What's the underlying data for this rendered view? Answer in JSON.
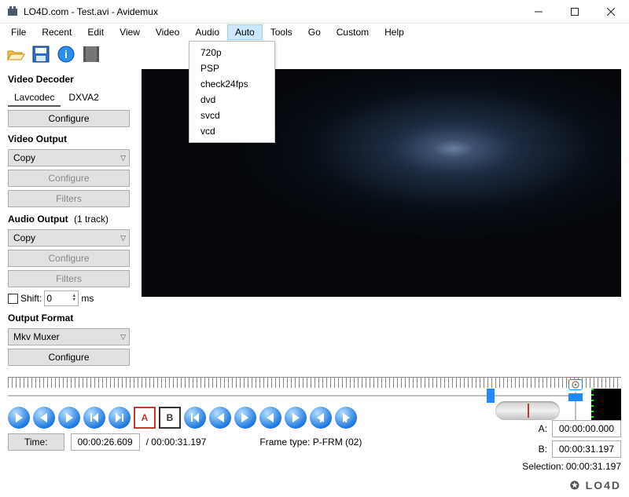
{
  "window": {
    "title": "LO4D.com - Test.avi - Avidemux"
  },
  "menu": {
    "items": [
      "File",
      "Recent",
      "Edit",
      "View",
      "Video",
      "Audio",
      "Auto",
      "Tools",
      "Go",
      "Custom",
      "Help"
    ],
    "open_index": 6,
    "dropdown": [
      "720p",
      "PSP",
      "check24fps",
      "dvd",
      "svcd",
      "vcd"
    ]
  },
  "toolbar_icons": [
    "open-icon",
    "save-icon",
    "info-icon",
    "film-icon"
  ],
  "sidebar": {
    "decoder": {
      "label": "Video Decoder",
      "tabs": [
        "Lavcodec",
        "DXVA2"
      ],
      "active_tab": 0,
      "configure": "Configure"
    },
    "video_out": {
      "label": "Video Output",
      "select": "Copy",
      "configure": "Configure",
      "filters": "Filters"
    },
    "audio_out": {
      "label": "Audio Output",
      "tracks_suffix": "(1 track)",
      "select": "Copy",
      "configure": "Configure",
      "filters": "Filters",
      "shift_label": "Shift:",
      "shift_value": "0",
      "shift_unit": "ms"
    },
    "output_fmt": {
      "label": "Output Format",
      "select": "Mkv Muxer",
      "configure": "Configure"
    }
  },
  "status": {
    "time_label": "Time:",
    "time_value": "00:00:26.609",
    "duration": "/ 00:00:31.197",
    "frame_type": "Frame type:  P-FRM (02)"
  },
  "selection": {
    "a_label": "A:",
    "a_value": "00:00:00.000",
    "b_label": "B:",
    "b_value": "00:00:31.197",
    "sel_label": "Selection:",
    "sel_value": "00:00:31.197"
  },
  "watermark": "✪ LO4D"
}
